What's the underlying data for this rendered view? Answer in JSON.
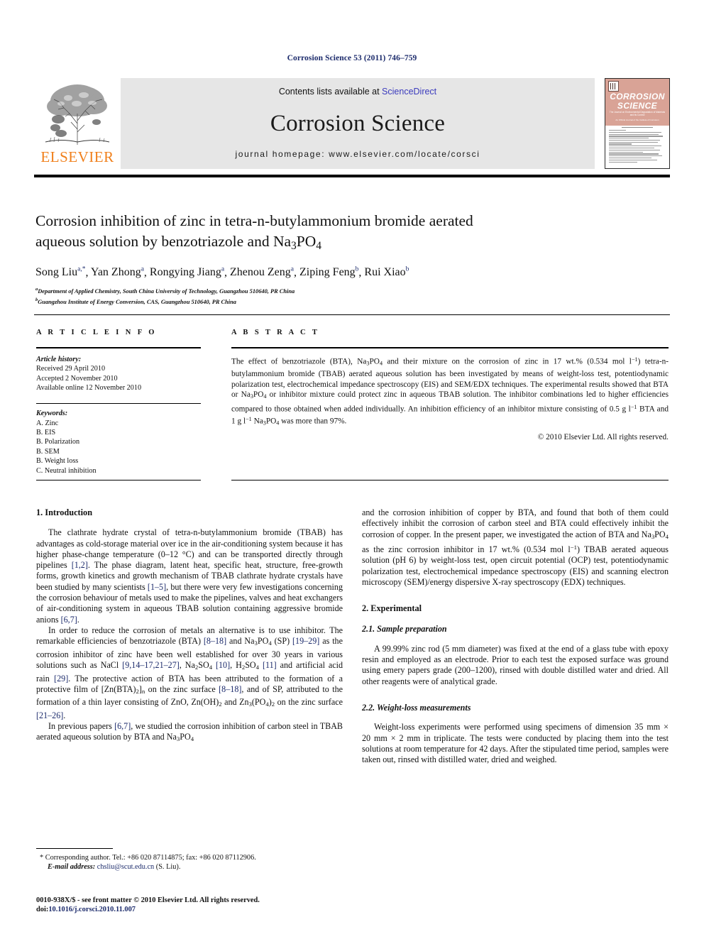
{
  "running_head": "Corrosion Science 53 (2011) 746–759",
  "masthead": {
    "contents_prefix": "Contents lists available at ",
    "sciencedirect": "ScienceDirect",
    "journal_title": "Corrosion Science",
    "homepage": "journal homepage: www.elsevier.com/locate/corsci",
    "publisher_wordmark": "ELSEVIER",
    "cover": {
      "line1": "CORROSION",
      "line2": "SCIENCE",
      "tagline": "The Journal on Environmental Degradation of Materials and its Control",
      "tagline2": "An Official Journal of the Institute of Corrosion"
    }
  },
  "article": {
    "title_line1": "Corrosion inhibition of zinc in tetra-n-butylammonium bromide aerated",
    "title_line2_pre": "aqueous solution by benzotriazole and Na",
    "title_line2_sub": "3",
    "title_line2_mid": "PO",
    "title_line2_sub2": "4",
    "authors": [
      {
        "name": "Song Liu",
        "sup": "a,*"
      },
      {
        "name": "Yan Zhong",
        "sup": "a"
      },
      {
        "name": "Rongying Jiang",
        "sup": "a"
      },
      {
        "name": "Zhenou Zeng",
        "sup": "a"
      },
      {
        "name": "Ziping Feng",
        "sup": "b"
      },
      {
        "name": "Rui Xiao",
        "sup": "b"
      }
    ],
    "affiliations": [
      {
        "sup": "a",
        "text": "Department of Applied Chemistry, South China University of Technology, Guangzhou 510640, PR China"
      },
      {
        "sup": "b",
        "text": "Guangzhou Institute of Energy Conversion, CAS, Guangzhou 510640, PR China"
      }
    ]
  },
  "article_info": {
    "heading": "A R T I C L E   I N F O",
    "history_label": "Article history:",
    "history": [
      "Received 29 April 2010",
      "Accepted 2 November 2010",
      "Available online 12 November 2010"
    ],
    "keywords_label": "Keywords:",
    "keywords": [
      "A. Zinc",
      "B. EIS",
      "B. Polarization",
      "B. SEM",
      "B. Weight loss",
      "C. Neutral inhibition"
    ]
  },
  "abstract": {
    "heading": "A B S T R A C T",
    "copyright": "© 2010 Elsevier Ltd. All rights reserved."
  },
  "sections": {
    "introduction_heading": "1. Introduction",
    "experimental_heading": "2. Experimental",
    "sample_prep_heading": "2.1. Sample preparation",
    "weight_loss_heading": "2.2. Weight-loss measurements"
  },
  "footnote": {
    "corresponding": "* Corresponding author. Tel.: +86 020 87114875; fax: +86 020 87112906.",
    "email_label": "E-mail address:",
    "email": "chsliu@scut.edu.cn",
    "email_suffix": "(S. Liu)."
  },
  "imprint": {
    "line1": "0010-938X/$ - see front matter © 2010 Elsevier Ltd. All rights reserved.",
    "doi_label": "doi:",
    "doi": "10.1016/j.corsci.2010.11.007"
  },
  "colors": {
    "link_blue": "#1b2a6b",
    "sciencedirect_blue": "#3b3bbd",
    "elsevier_orange": "#f07f1a",
    "masthead_grey": "#e6e6e6",
    "cover_salmon": "#d9a396"
  }
}
